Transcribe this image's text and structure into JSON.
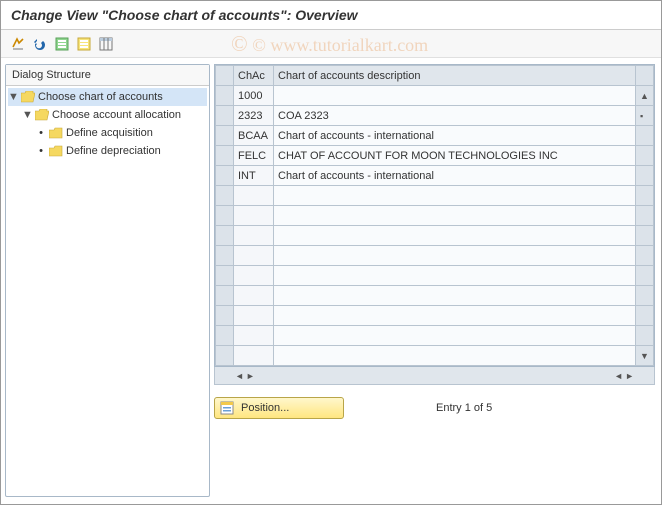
{
  "title": "Change View \"Choose chart of accounts\": Overview",
  "watermark": "© www.tutorialkart.com",
  "sidebar": {
    "header": "Dialog Structure",
    "items": [
      {
        "label": "Choose chart of accounts",
        "selected": true,
        "type": "folder-open",
        "expand": true,
        "indent": 0
      },
      {
        "label": "Choose account allocation",
        "selected": false,
        "type": "folder-open",
        "expand": true,
        "indent": 1
      },
      {
        "label": "Define acquisition",
        "selected": false,
        "type": "folder",
        "expand": false,
        "indent": 2,
        "bullet": true
      },
      {
        "label": "Define depreciation",
        "selected": false,
        "type": "folder",
        "expand": false,
        "indent": 2,
        "bullet": true
      }
    ]
  },
  "table": {
    "columns": [
      {
        "key": "chac",
        "label": "ChAc"
      },
      {
        "key": "desc",
        "label": "Chart of accounts description"
      }
    ],
    "rows": [
      {
        "chac": "1000",
        "desc": ""
      },
      {
        "chac": "2323",
        "desc": "COA 2323"
      },
      {
        "chac": "BCAA",
        "desc": "Chart of accounts - international"
      },
      {
        "chac": "FELC",
        "desc": "CHAT OF ACCOUNT FOR MOON TECHNOLOGIES INC"
      },
      {
        "chac": "INT",
        "desc": "Chart of accounts - international"
      },
      {
        "chac": "",
        "desc": ""
      },
      {
        "chac": "",
        "desc": ""
      },
      {
        "chac": "",
        "desc": ""
      },
      {
        "chac": "",
        "desc": ""
      },
      {
        "chac": "",
        "desc": ""
      },
      {
        "chac": "",
        "desc": ""
      },
      {
        "chac": "",
        "desc": ""
      },
      {
        "chac": "",
        "desc": ""
      },
      {
        "chac": "",
        "desc": ""
      }
    ]
  },
  "footer": {
    "position_label": "Position...",
    "entry_label": "Entry 1 of 5"
  }
}
